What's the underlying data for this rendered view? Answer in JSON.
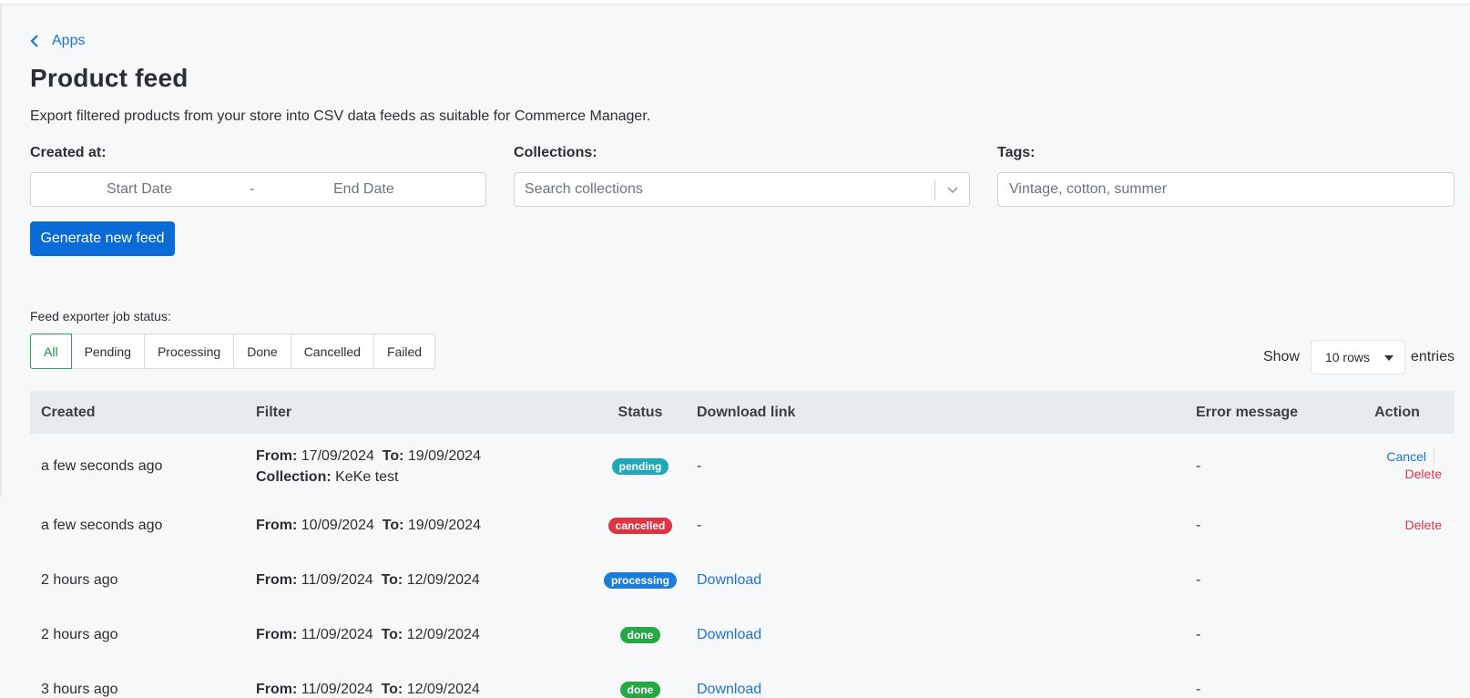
{
  "nav": {
    "back_label": "Apps"
  },
  "page": {
    "title": "Product feed",
    "subtitle": "Export filtered products from your store into CSV data feeds as suitable for Commerce Manager."
  },
  "form": {
    "created_label": "Created at:",
    "start_placeholder": "Start Date",
    "range_separator": "-",
    "end_placeholder": "End Date",
    "collections_label": "Collections:",
    "collections_placeholder": "Search collections",
    "tags_label": "Tags:",
    "tags_placeholder": "Vintage, cotton, summer",
    "generate_button": "Generate new feed"
  },
  "jobs": {
    "status_label": "Feed exporter job status:",
    "filters": [
      "All",
      "Pending",
      "Processing",
      "Done",
      "Cancelled",
      "Failed"
    ],
    "active_filter": "All",
    "show_label": "Show",
    "rows_value": "10 rows",
    "entries_label": "entries"
  },
  "table": {
    "headers": [
      "Created",
      "Filter",
      "Status",
      "Download link",
      "Error message",
      "Action"
    ],
    "rows": [
      {
        "created": "a few seconds ago",
        "from_label": "From:",
        "from": "17/09/2024",
        "to_label": "To:",
        "to": "19/09/2024",
        "collection_label": "Collection:",
        "collection": "KeKe test",
        "status": "pending",
        "download": "-",
        "error": "-",
        "actions": [
          "Cancel",
          "Delete"
        ]
      },
      {
        "created": "a few seconds ago",
        "from_label": "From:",
        "from": "10/09/2024",
        "to_label": "To:",
        "to": "19/09/2024",
        "status": "cancelled",
        "download": "-",
        "error": "-",
        "actions": [
          "Delete"
        ]
      },
      {
        "created": "2 hours ago",
        "from_label": "From:",
        "from": "11/09/2024",
        "to_label": "To:",
        "to": "12/09/2024",
        "status": "processing",
        "download": "Download",
        "error": "-",
        "actions": []
      },
      {
        "created": "2 hours ago",
        "from_label": "From:",
        "from": "11/09/2024",
        "to_label": "To:",
        "to": "12/09/2024",
        "status": "done",
        "download": "Download",
        "error": "-",
        "actions": []
      },
      {
        "created": "3 hours ago",
        "from_label": "From:",
        "from": "11/09/2024",
        "to_label": "To:",
        "to": "12/09/2024",
        "status": "done",
        "download": "Download",
        "error": "-",
        "actions": []
      }
    ]
  },
  "colors": {
    "accent": "#0b6bd6",
    "link": "#1e73d6",
    "pending": "#20a8b8",
    "cancelled": "#dc3545",
    "processing": "#1a7ddd",
    "done": "#28a745",
    "active_filter": "#2aa45a"
  }
}
